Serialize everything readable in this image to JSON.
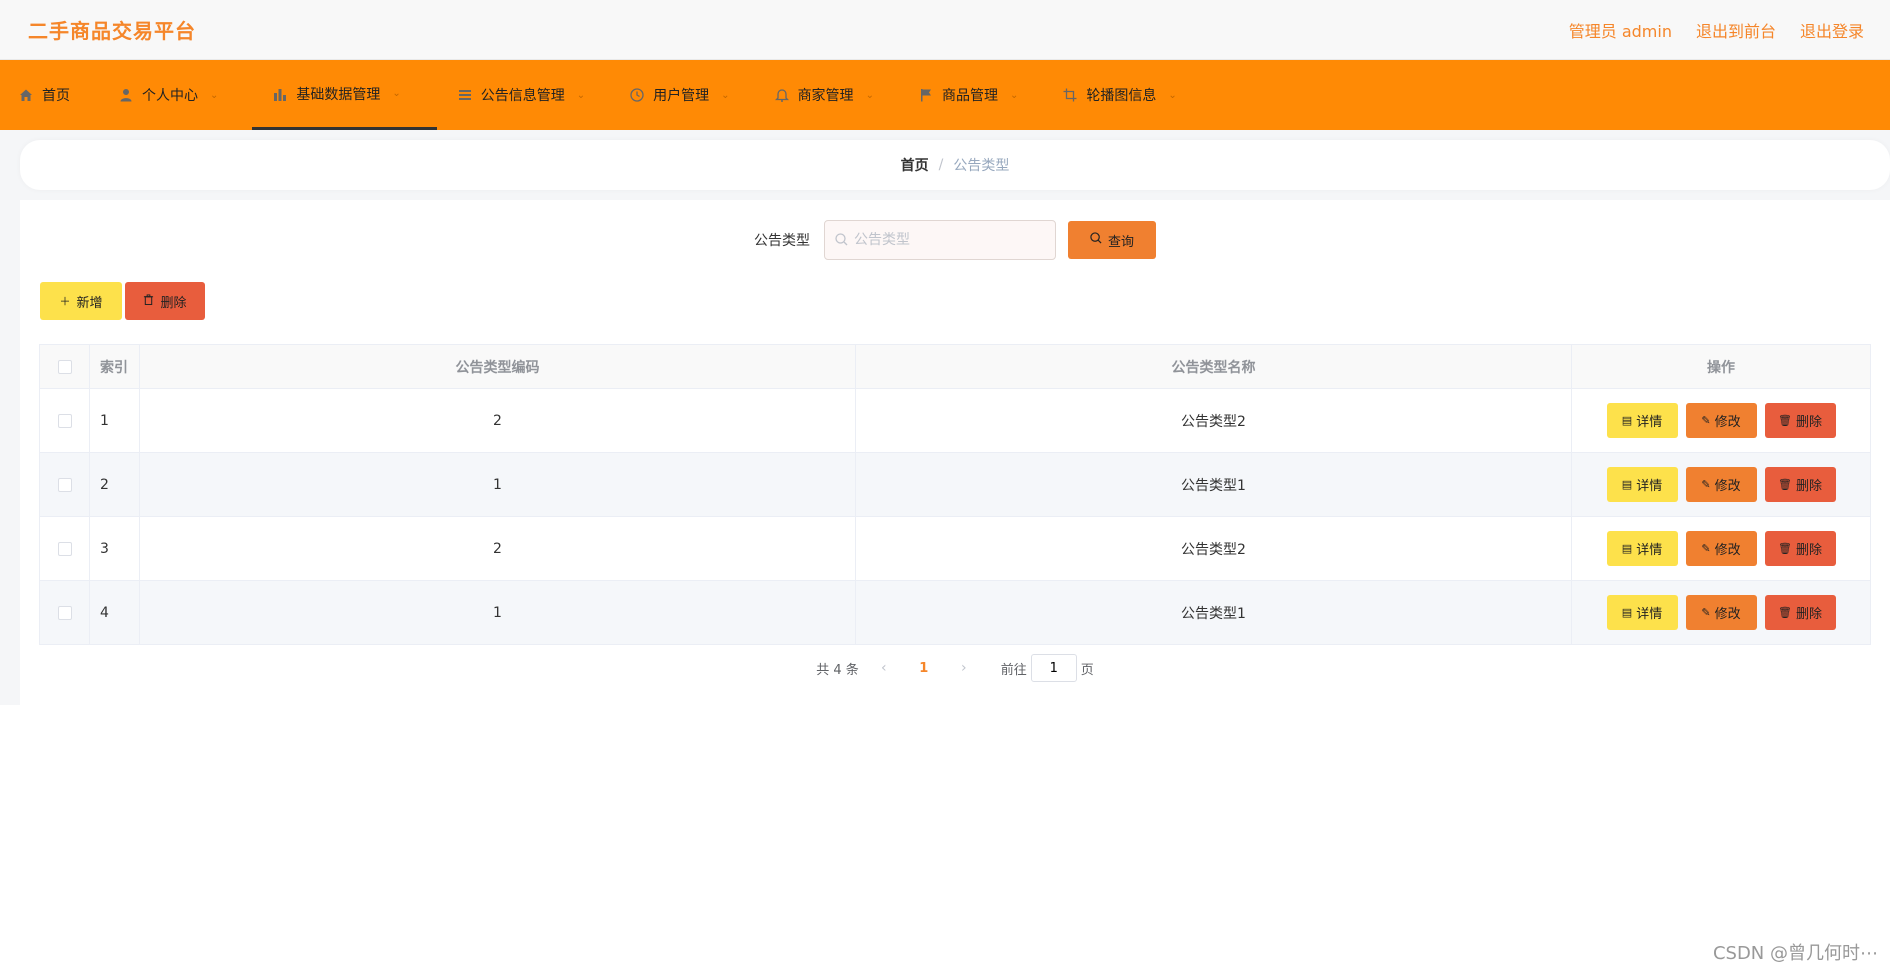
{
  "header": {
    "title": "二手商品交易平台",
    "links": [
      "管理员 admin",
      "退出到前台",
      "退出登录"
    ]
  },
  "nav": {
    "items": [
      {
        "label": "首页",
        "icon": "home-icon"
      },
      {
        "label": "个人中心",
        "icon": "user-icon"
      },
      {
        "label": "基础数据管理",
        "icon": "bar-chart-icon"
      },
      {
        "label": "公告信息管理",
        "icon": "list-icon"
      },
      {
        "label": "用户管理",
        "icon": "clock-icon"
      },
      {
        "label": "商家管理",
        "icon": "bell-icon"
      },
      {
        "label": "商品管理",
        "icon": "flag-icon"
      },
      {
        "label": "轮播图信息",
        "icon": "crop-icon"
      }
    ],
    "active_index": 2
  },
  "breadcrumb": {
    "home": "首页",
    "separator": "/",
    "current": "公告类型"
  },
  "search": {
    "label": "公告类型",
    "placeholder": "公告类型",
    "query_button": "查询"
  },
  "actions": {
    "add_button": "新增",
    "delete_button": "删除"
  },
  "table": {
    "headers": {
      "index": "索引",
      "code": "公告类型编码",
      "name": "公告类型名称",
      "ops": "操作"
    },
    "rows": [
      {
        "index": "1",
        "code": "2",
        "name": "公告类型2"
      },
      {
        "index": "2",
        "code": "1",
        "name": "公告类型1"
      },
      {
        "index": "3",
        "code": "2",
        "name": "公告类型2"
      },
      {
        "index": "4",
        "code": "1",
        "name": "公告类型1"
      }
    ],
    "row_actions": {
      "detail": "详情",
      "edit": "修改",
      "delete": "删除"
    }
  },
  "pagination": {
    "total_text": "共 4 条",
    "current_page": "1",
    "goto_prefix": "前往",
    "goto_value": "1",
    "goto_suffix": "页"
  },
  "watermark": "CSDN @曾几何时⋯",
  "colors": {
    "brand": "#f5862a",
    "nav_bg": "#ff8a05",
    "detail_button": "#fde14b",
    "edit_button": "#f08030",
    "delete_button": "#e85d3d"
  }
}
